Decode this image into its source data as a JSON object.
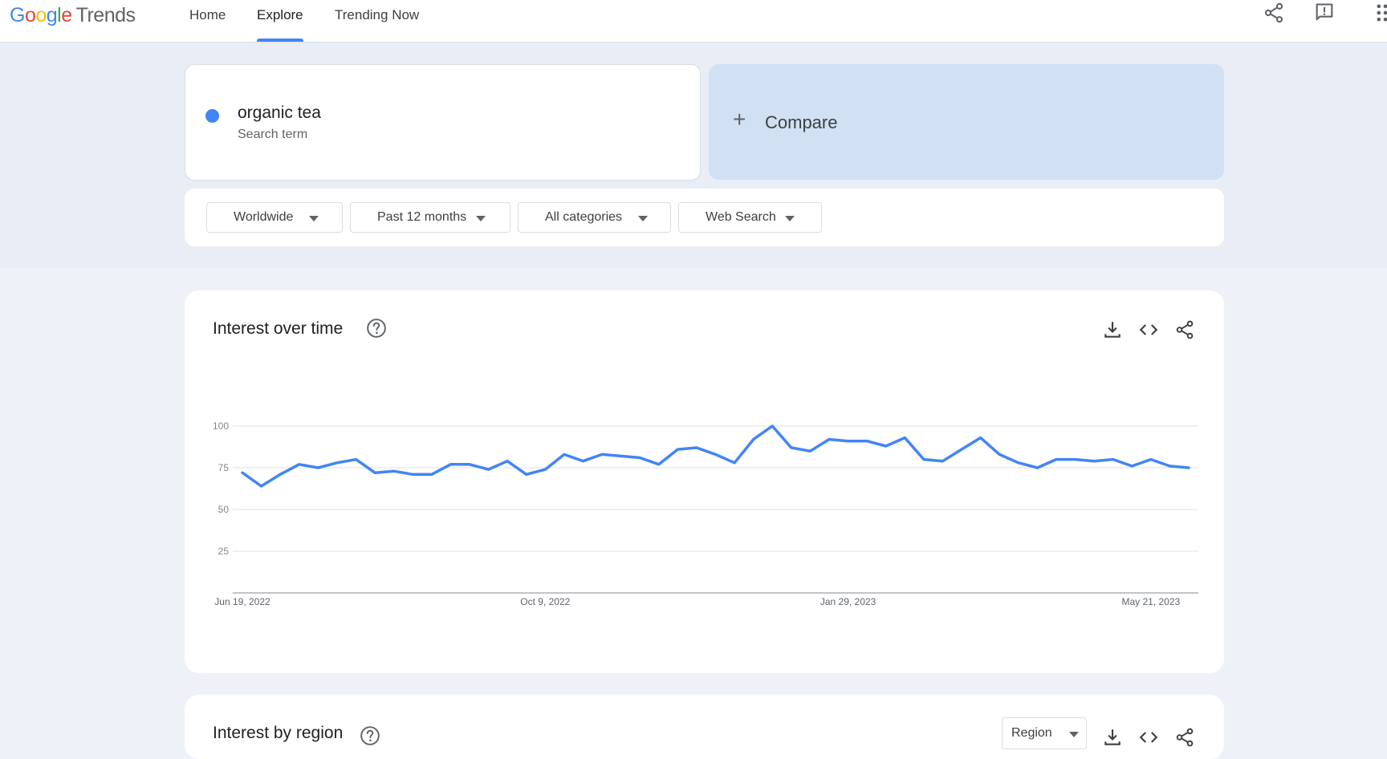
{
  "header": {
    "logo": {
      "google": "Google",
      "trends": "Trends"
    },
    "nav": [
      {
        "label": "Home"
      },
      {
        "label": "Explore",
        "active": true
      },
      {
        "label": "Trending Now"
      }
    ],
    "icons": [
      "share-icon",
      "feedback-icon",
      "apps-icon"
    ]
  },
  "search": {
    "term": "organic tea",
    "term_type": "Search term",
    "term_color": "#4285f4",
    "compare_label": "Compare"
  },
  "filters": {
    "region": "Worldwide",
    "time": "Past 12 months",
    "category": "All categories",
    "property": "Web Search"
  },
  "interest_over_time": {
    "title": "Interest over time"
  },
  "interest_by_region": {
    "title": "Interest by region",
    "resolution": "Region"
  },
  "chart_data": {
    "type": "line",
    "title": "",
    "xlabel": "",
    "ylabel": "",
    "ylim": [
      0,
      100
    ],
    "yticks": [
      25,
      50,
      75,
      100
    ],
    "grid": true,
    "x_tick_labels": [
      "Jun 19, 2022",
      "Oct 9, 2022",
      "Jan 29, 2023",
      "May 21, 2023"
    ],
    "x_tick_index": [
      0,
      16,
      32,
      48
    ],
    "series": [
      {
        "name": "organic tea",
        "color": "#4285f4",
        "values": [
          72,
          64,
          71,
          77,
          75,
          78,
          80,
          72,
          73,
          71,
          71,
          77,
          77,
          74,
          79,
          71,
          74,
          83,
          79,
          83,
          82,
          81,
          77,
          86,
          87,
          83,
          78,
          92,
          100,
          87,
          85,
          92,
          91,
          91,
          88,
          93,
          80,
          79,
          86,
          93,
          83,
          78,
          75,
          80,
          80,
          79,
          80,
          76,
          80,
          76,
          75
        ]
      }
    ]
  }
}
